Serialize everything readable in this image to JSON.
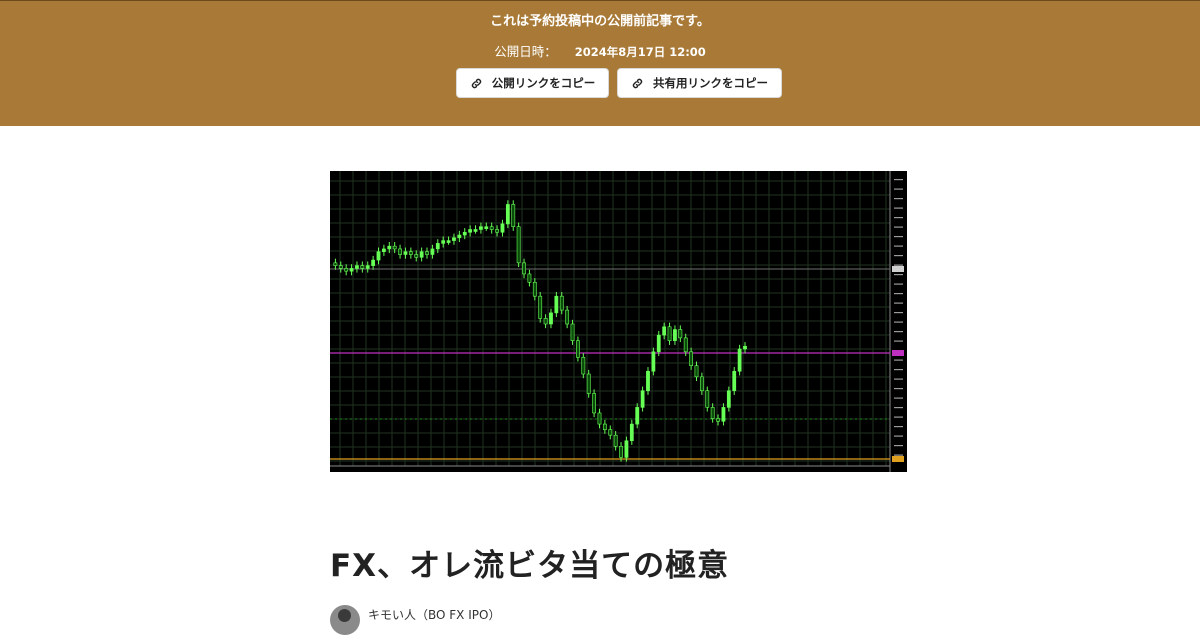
{
  "banner": {
    "message": "これは予約投稿中の公開前記事です。",
    "date_label": "公開日時：",
    "date_value": "2024年8月17日 12:00",
    "copy_public_link": "公開リンクをコピー",
    "copy_share_link": "共有用リンクをコピー",
    "link_icon": "link-icon",
    "background_color": "#a97a37"
  },
  "article": {
    "title": "FX、オレ流ビタ当ての極意",
    "author": "キモい人（BO FX IPO）"
  },
  "chart_data": {
    "type": "candlestick",
    "title": "",
    "xlabel": "",
    "ylabel": "",
    "close_path": [
      0.72,
      0.71,
      0.7,
      0.69,
      0.7,
      0.71,
      0.7,
      0.71,
      0.73,
      0.76,
      0.77,
      0.78,
      0.77,
      0.75,
      0.76,
      0.75,
      0.74,
      0.76,
      0.75,
      0.77,
      0.79,
      0.8,
      0.8,
      0.81,
      0.82,
      0.83,
      0.84,
      0.84,
      0.85,
      0.85,
      0.84,
      0.83,
      0.86,
      0.93,
      0.85,
      0.72,
      0.68,
      0.65,
      0.6,
      0.52,
      0.5,
      0.54,
      0.6,
      0.55,
      0.5,
      0.44,
      0.38,
      0.32,
      0.25,
      0.18,
      0.14,
      0.12,
      0.1,
      0.06,
      0.02,
      0.08,
      0.14,
      0.2,
      0.26,
      0.33,
      0.4,
      0.46,
      0.49,
      0.44,
      0.48,
      0.45,
      0.4,
      0.35,
      0.31,
      0.26,
      0.2,
      0.16,
      0.15,
      0.2,
      0.26,
      0.33,
      0.41,
      0.42
    ],
    "colors": {
      "background": "#000000",
      "bull": "#66ff55",
      "bear": "#0a4a0a",
      "grid": "#1f331f",
      "magenta_line": "#c030c0",
      "orange_line": "#e0a020",
      "gray_line": "#707070",
      "dotted_line": "#1f8a1f"
    },
    "grid": true
  }
}
